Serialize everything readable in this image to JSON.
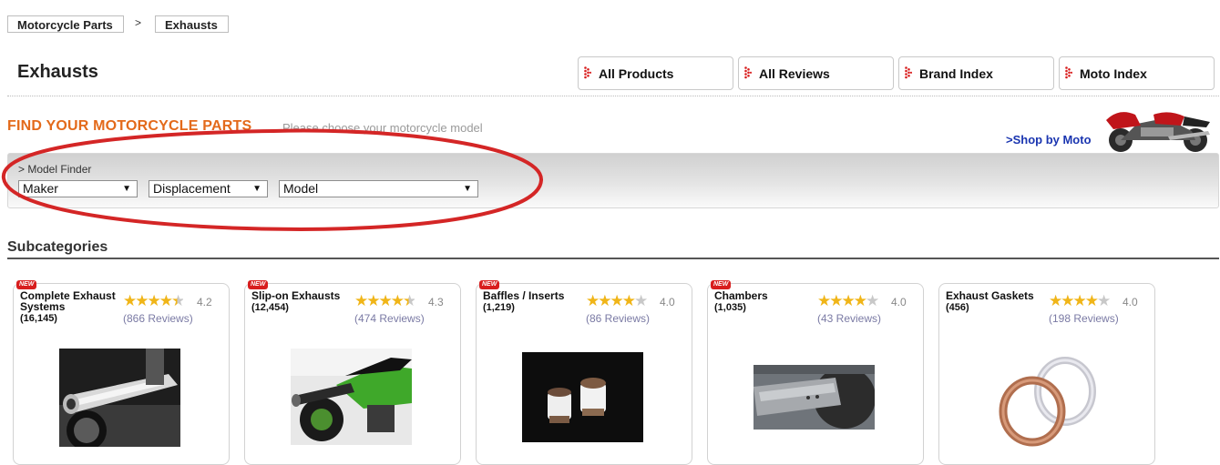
{
  "breadcrumb": {
    "items": [
      "Motorcycle Parts",
      "Exhausts"
    ],
    "separator": ">"
  },
  "page": {
    "title": "Exhausts"
  },
  "nav": {
    "buttons": [
      "All Products",
      "All Reviews",
      "Brand Index",
      "Moto Index"
    ]
  },
  "finder": {
    "title": "FIND YOUR MOTORCYCLE PARTS",
    "subtitle": "Please choose your motorcycle model",
    "shop_link": ">Shop by Moto",
    "label": "> Model Finder",
    "selects": [
      "Maker",
      "Displacement",
      "Model"
    ]
  },
  "subcategories": {
    "title": "Subcategories",
    "new_badge": "NEW",
    "cards": [
      {
        "name": "Complete Exhaust Systems",
        "count": "(16,145)",
        "rating": "4.2",
        "reviews": "(866 Reviews)",
        "stars": 4.5,
        "new": true
      },
      {
        "name": "Slip-on Exhausts",
        "count": "(12,454)",
        "rating": "4.3",
        "reviews": "(474 Reviews)",
        "stars": 4.5,
        "new": true
      },
      {
        "name": "Baffles / Inserts",
        "count": "(1,219)",
        "rating": "4.0",
        "reviews": "(86 Reviews)",
        "stars": 4,
        "new": true
      },
      {
        "name": "Chambers",
        "count": "(1,035)",
        "rating": "4.0",
        "reviews": "(43 Reviews)",
        "stars": 4,
        "new": true
      },
      {
        "name": "Exhaust Gaskets",
        "count": "(456)",
        "rating": "4.0",
        "reviews": "(198 Reviews)",
        "stars": 4,
        "new": false
      }
    ]
  },
  "colors": {
    "accent_orange": "#e36a1b",
    "link_blue": "#1a35b0",
    "annotation_red": "#d42626",
    "star_gold": "#f0b518"
  }
}
